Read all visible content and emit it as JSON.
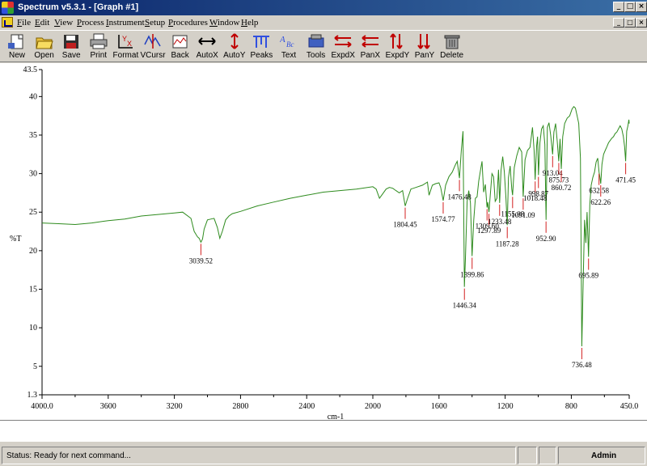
{
  "window": {
    "title": "Spectrum v5.3.1 - [Graph #1]",
    "caption_buttons": [
      "_",
      "□",
      "×"
    ]
  },
  "menu": {
    "items": [
      "File",
      "Edit",
      "View",
      "Process",
      "Instrument",
      "Setup",
      "Procedures",
      "Window",
      "Help"
    ],
    "accelerators": [
      "F",
      "E",
      "V",
      "P",
      "I",
      "S",
      "P",
      "W",
      "H"
    ]
  },
  "toolbar": {
    "buttons": [
      {
        "label": "New",
        "icon": "new-document-icon"
      },
      {
        "label": "Open",
        "icon": "open-folder-icon"
      },
      {
        "label": "Save",
        "icon": "save-disk-icon"
      },
      {
        "label": "Print",
        "icon": "printer-icon"
      },
      {
        "label": "Format",
        "icon": "format-axes-icon"
      },
      {
        "label": "VCursr",
        "icon": "vertical-cursor-icon"
      },
      {
        "label": "Back",
        "icon": "background-icon"
      },
      {
        "label": "AutoX",
        "icon": "auto-x-icon"
      },
      {
        "label": "AutoY",
        "icon": "auto-y-icon"
      },
      {
        "label": "Peaks",
        "icon": "peaks-icon"
      },
      {
        "label": "Text",
        "icon": "text-icon"
      },
      {
        "label": "Tools",
        "icon": "tools-icon"
      },
      {
        "label": "ExpdX",
        "icon": "expand-x-icon"
      },
      {
        "label": "PanX",
        "icon": "pan-x-icon"
      },
      {
        "label": "ExpdY",
        "icon": "expand-y-icon"
      },
      {
        "label": "PanY",
        "icon": "pan-y-icon"
      },
      {
        "label": "Delete",
        "icon": "delete-trash-icon"
      }
    ]
  },
  "chart_data": {
    "type": "line",
    "ylabel": "%T",
    "xlabel": "cm-1",
    "xlim": [
      4000.0,
      450.0
    ],
    "ylim": [
      1.3,
      43.5
    ],
    "x_ticks": [
      "4000.0",
      "3600",
      "3200",
      "2800",
      "2400",
      "2000",
      "1600",
      "1200",
      "800",
      "450.0"
    ],
    "x_tick_values": [
      4000,
      3600,
      3200,
      2800,
      2400,
      2000,
      1600,
      1200,
      800,
      450
    ],
    "x_minor_ticks": [
      "3800",
      "3400",
      "3000",
      "2600",
      "2200",
      "1800",
      "1400",
      "1000",
      "600"
    ],
    "x_minor_tick_values": [
      3800,
      3400,
      3000,
      2600,
      2200,
      1800,
      1400,
      1000,
      600
    ],
    "y_ticks": [
      "43.5",
      "40",
      "35",
      "30",
      "25",
      "20",
      "15",
      "10",
      "5",
      "1.3"
    ],
    "y_tick_values": [
      43.5,
      40,
      35,
      30,
      25,
      20,
      15,
      10,
      5,
      1.3
    ],
    "grid": false,
    "line_color": "#2e8b1e",
    "peak_marker_color": "#d32020",
    "series": [
      {
        "x": [
          4000,
          3900,
          3800,
          3700,
          3600,
          3500,
          3400,
          3300,
          3200,
          3150,
          3100,
          3080,
          3060,
          3050,
          3039.52,
          3030,
          3020,
          3000,
          2980,
          2960,
          2940,
          2925,
          2910,
          2890,
          2870,
          2850,
          2800,
          2700,
          2600,
          2500,
          2400,
          2300,
          2200,
          2100,
          2000,
          1980,
          1960,
          1940,
          1920,
          1900,
          1880,
          1860,
          1840,
          1820,
          1804.45,
          1790,
          1770,
          1740,
          1700,
          1670,
          1660,
          1640,
          1620,
          1600,
          1590,
          1574.77,
          1560,
          1540,
          1520,
          1500,
          1490,
          1476.48,
          1465,
          1455,
          1446.34,
          1440,
          1430,
          1420,
          1410,
          1399.86,
          1390,
          1380,
          1370,
          1360,
          1350,
          1340,
          1330,
          1320,
          1309.6,
          1305,
          1297.89,
          1290,
          1280,
          1270,
          1260,
          1250,
          1240,
          1233.48,
          1225,
          1215,
          1205,
          1195,
          1187.28,
          1180,
          1170,
          1160,
          1155.08,
          1145,
          1130,
          1115,
          1100,
          1091.09,
          1080,
          1065,
          1050,
          1035,
          1025,
          1018.48,
          1010,
          1004,
          998.87,
          990,
          980,
          970,
          960,
          952.9,
          945,
          935,
          925,
          913.04,
          905,
          895,
          885,
          875.73,
          868,
          860.72,
          852,
          840,
          825,
          810,
          795,
          785,
          775,
          765,
          755,
          745,
          736.48,
          728,
          720,
          712,
          705,
          695.89,
          688,
          680,
          670,
          660,
          650,
          640,
          632.58,
          627,
          622.26,
          615,
          605,
          595,
          585,
          575,
          565,
          555,
          545,
          535,
          525,
          515,
          505,
          495,
          485,
          478,
          471.45,
          465,
          458,
          452,
          450
        ],
        "y": [
          23.6,
          23.5,
          23.4,
          23.6,
          23.9,
          24.1,
          24.5,
          24.7,
          24.9,
          25.0,
          24.2,
          22.5,
          21.8,
          21.6,
          21.1,
          21.5,
          22.8,
          24.0,
          24.1,
          24.2,
          23.0,
          21.6,
          22.5,
          24.0,
          24.5,
          24.8,
          25.1,
          25.8,
          26.3,
          26.8,
          27.2,
          27.6,
          27.8,
          28.0,
          28.3,
          28.0,
          26.8,
          27.4,
          28.0,
          28.2,
          28.1,
          27.8,
          27.5,
          27.8,
          25.8,
          26.8,
          28.0,
          28.2,
          28.5,
          28.9,
          27.2,
          28.5,
          28.7,
          28.8,
          28.2,
          26.5,
          28.5,
          29.6,
          30.2,
          31.2,
          31.6,
          29.4,
          33.0,
          35.5,
          15.3,
          19.0,
          26.4,
          27.8,
          26.2,
          19.3,
          24.0,
          26.8,
          27.0,
          29.0,
          30.3,
          31.6,
          27.6,
          28.6,
          25.6,
          26.3,
          25.0,
          27.2,
          30.0,
          29.6,
          26.4,
          26.8,
          30.5,
          26.2,
          30.4,
          32.2,
          30.2,
          26.8,
          23.3,
          29.5,
          31.0,
          28.0,
          27.2,
          30.8,
          32.3,
          33.4,
          32.8,
          27.0,
          31.8,
          33.0,
          33.4,
          36.0,
          33.0,
          29.2,
          33.6,
          34.8,
          29.8,
          34.0,
          35.8,
          36.2,
          33.8,
          24.0,
          36.0,
          36.6,
          35.0,
          32.5,
          35.4,
          36.5,
          34.2,
          31.6,
          34.5,
          30.6,
          34.8,
          36.5,
          37.2,
          37.5,
          38.4,
          38.7,
          38.5,
          37.5,
          36.5,
          32.0,
          7.6,
          16.0,
          24.0,
          21.0,
          25.0,
          19.2,
          26.0,
          28.5,
          29.5,
          30.2,
          31.5,
          32.0,
          30.2,
          29.5,
          28.7,
          31.2,
          32.5,
          33.0,
          33.5,
          34.0,
          34.3,
          34.6,
          34.8,
          35.2,
          35.4,
          35.8,
          36.2,
          35.8,
          34.8,
          33.5,
          31.6,
          35.5,
          36.2,
          37.0,
          36.5
        ]
      }
    ],
    "peak_labels": [
      {
        "label": "3039.52",
        "x": 3039.52,
        "y": 21.1
      },
      {
        "label": "1804.45",
        "x": 1804.45,
        "y": 25.8
      },
      {
        "label": "1574.77",
        "x": 1574.77,
        "y": 26.5
      },
      {
        "label": "1476.48",
        "x": 1476.48,
        "y": 29.4
      },
      {
        "label": "1446.34",
        "x": 1446.34,
        "y": 15.3
      },
      {
        "label": "1399.86",
        "x": 1399.86,
        "y": 19.3
      },
      {
        "label": "1309.60",
        "x": 1309.6,
        "y": 25.6
      },
      {
        "label": "1297.89",
        "x": 1297.89,
        "y": 25.0
      },
      {
        "label": "1233.48",
        "x": 1233.48,
        "y": 26.2
      },
      {
        "label": "1187.28",
        "x": 1187.28,
        "y": 23.3
      },
      {
        "label": "1155.08",
        "x": 1155.08,
        "y": 27.2
      },
      {
        "label": "1091.09",
        "x": 1091.09,
        "y": 27.0
      },
      {
        "label": "1018.48",
        "x": 1018.48,
        "y": 29.2
      },
      {
        "label": "998.87",
        "x": 998.87,
        "y": 29.8
      },
      {
        "label": "952.90",
        "x": 952.9,
        "y": 24.0
      },
      {
        "label": "913.04",
        "x": 913.04,
        "y": 32.5
      },
      {
        "label": "875.73",
        "x": 875.73,
        "y": 31.6
      },
      {
        "label": "860.72",
        "x": 860.72,
        "y": 30.6
      },
      {
        "label": "736.48",
        "x": 736.48,
        "y": 7.6
      },
      {
        "label": "695.89",
        "x": 695.89,
        "y": 19.2
      },
      {
        "label": "632.58",
        "x": 632.58,
        "y": 30.2
      },
      {
        "label": "622.26",
        "x": 622.26,
        "y": 28.7
      },
      {
        "label": "471.45",
        "x": 471.45,
        "y": 31.6
      }
    ]
  },
  "status": {
    "text": "Status: Ready for next command...",
    "user": "Admin"
  }
}
